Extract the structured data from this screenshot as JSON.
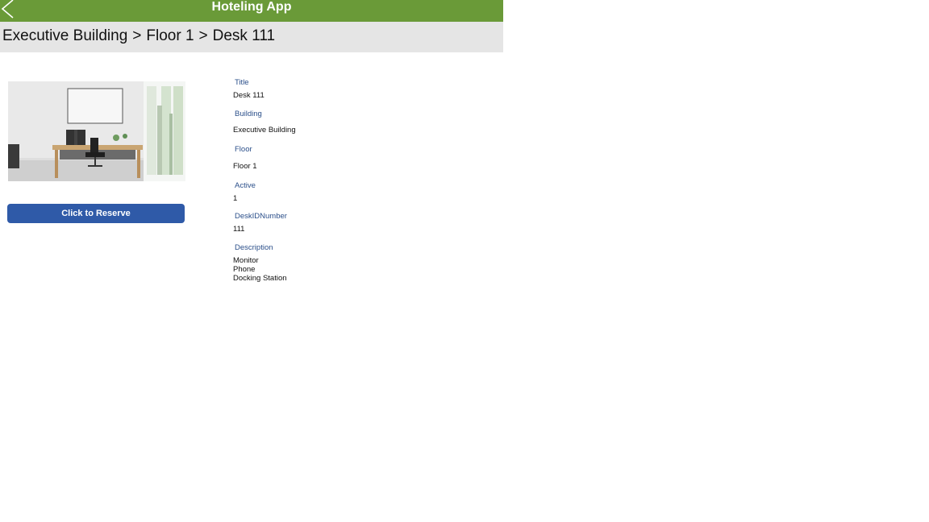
{
  "header": {
    "title": "Hoteling App",
    "back_icon": "chevron-left-icon"
  },
  "breadcrumb": {
    "items": [
      "Executive Building",
      "Floor 1",
      "Desk 111"
    ],
    "separator": ">"
  },
  "actions": {
    "reserve_label": "Click to Reserve"
  },
  "colors": {
    "header": "#6a9a38",
    "button": "#2f5aa8",
    "label": "#2b4f8a",
    "breadcrumb_bg": "#e5e5e5"
  },
  "fields": {
    "title": {
      "label": "Title",
      "value": "Desk 111"
    },
    "building": {
      "label": "Building",
      "value": "Executive Building"
    },
    "floor": {
      "label": "Floor",
      "value": "Floor 1"
    },
    "active": {
      "label": "Active",
      "value": "1"
    },
    "desk_id": {
      "label": "DeskIDNumber",
      "value": "111"
    },
    "description": {
      "label": "Description",
      "lines": [
        "Monitor",
        "Phone",
        "Docking Station"
      ]
    }
  }
}
